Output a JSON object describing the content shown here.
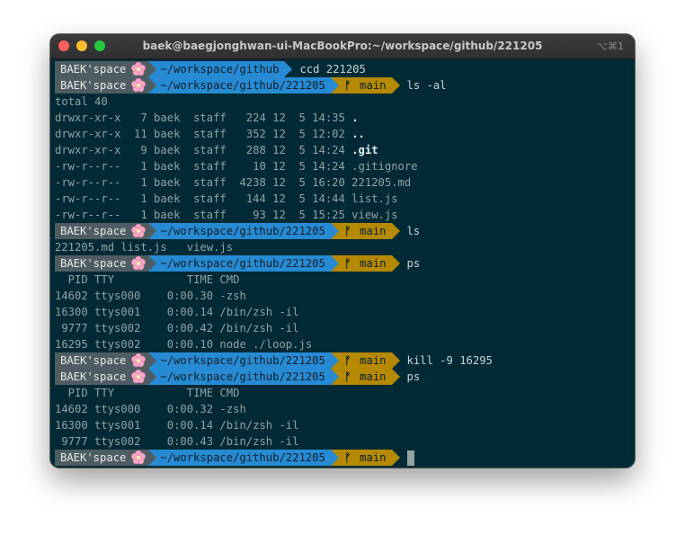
{
  "window": {
    "title": "baek@baegjonghwan-ui-MacBookPro:~/workspace/github/221205",
    "shortcut": "⌥⌘1"
  },
  "prompt": {
    "user": "BAEK'space",
    "flower_icon": "cherry-blossom-icon",
    "branch_icon": "git-branch-icon",
    "branch_glyph": "ᚠ"
  },
  "colors": {
    "terminal_bg": "#002b36",
    "user_segment": "#4e5d63",
    "dir_segment": "#268bd2",
    "git_segment": "#b58900"
  },
  "lines": [
    {
      "type": "prompt",
      "dir": "~/workspace/github",
      "branch": "",
      "cmd": "ccd 221205"
    },
    {
      "type": "prompt",
      "dir": "~/workspace/github/221205",
      "branch": "main",
      "cmd": "ls -al"
    },
    {
      "type": "out",
      "text": "total 40"
    },
    {
      "type": "out",
      "text": "drwxr-xr-x   7 baek  staff   224 12  5 14:35 ",
      "bold": "."
    },
    {
      "type": "out",
      "text": "drwxr-xr-x  11 baek  staff   352 12  5 12:02 ",
      "bold": ".."
    },
    {
      "type": "out",
      "text": "drwxr-xr-x   9 baek  staff   288 12  5 14:24 ",
      "bold": ".git"
    },
    {
      "type": "out",
      "text": "-rw-r--r--   1 baek  staff    10 12  5 14:24 .gitignore"
    },
    {
      "type": "out",
      "text": "-rw-r--r--   1 baek  staff  4238 12  5 16:20 221205.md"
    },
    {
      "type": "out",
      "text": "-rw-r--r--   1 baek  staff   144 12  5 14:44 list.js"
    },
    {
      "type": "out",
      "text": "-rw-r--r--   1 baek  staff    93 12  5 15:25 view.js"
    },
    {
      "type": "prompt",
      "dir": "~/workspace/github/221205",
      "branch": "main",
      "cmd": "ls"
    },
    {
      "type": "out",
      "text": "221205.md list.js   view.js"
    },
    {
      "type": "prompt",
      "dir": "~/workspace/github/221205",
      "branch": "main",
      "cmd": "ps"
    },
    {
      "type": "out",
      "text": "  PID TTY           TIME CMD"
    },
    {
      "type": "out",
      "text": "14602 ttys000    0:00.30 -zsh"
    },
    {
      "type": "out",
      "text": "16300 ttys001    0:00.14 /bin/zsh -il"
    },
    {
      "type": "out",
      "text": " 9777 ttys002    0:00.42 /bin/zsh -il"
    },
    {
      "type": "out",
      "text": "16295 ttys002    0:00.10 node ./loop.js"
    },
    {
      "type": "prompt",
      "dir": "~/workspace/github/221205",
      "branch": "main",
      "cmd": "kill -9 16295"
    },
    {
      "type": "prompt",
      "dir": "~/workspace/github/221205",
      "branch": "main",
      "cmd": "ps"
    },
    {
      "type": "out",
      "text": "  PID TTY           TIME CMD"
    },
    {
      "type": "out",
      "text": "14602 ttys000    0:00.32 -zsh"
    },
    {
      "type": "out",
      "text": "16300 ttys001    0:00.14 /bin/zsh -il"
    },
    {
      "type": "out",
      "text": " 9777 ttys002    0:00.43 /bin/zsh -il"
    },
    {
      "type": "prompt",
      "dir": "~/workspace/github/221205",
      "branch": "main",
      "cmd": "",
      "cursor": true
    }
  ]
}
